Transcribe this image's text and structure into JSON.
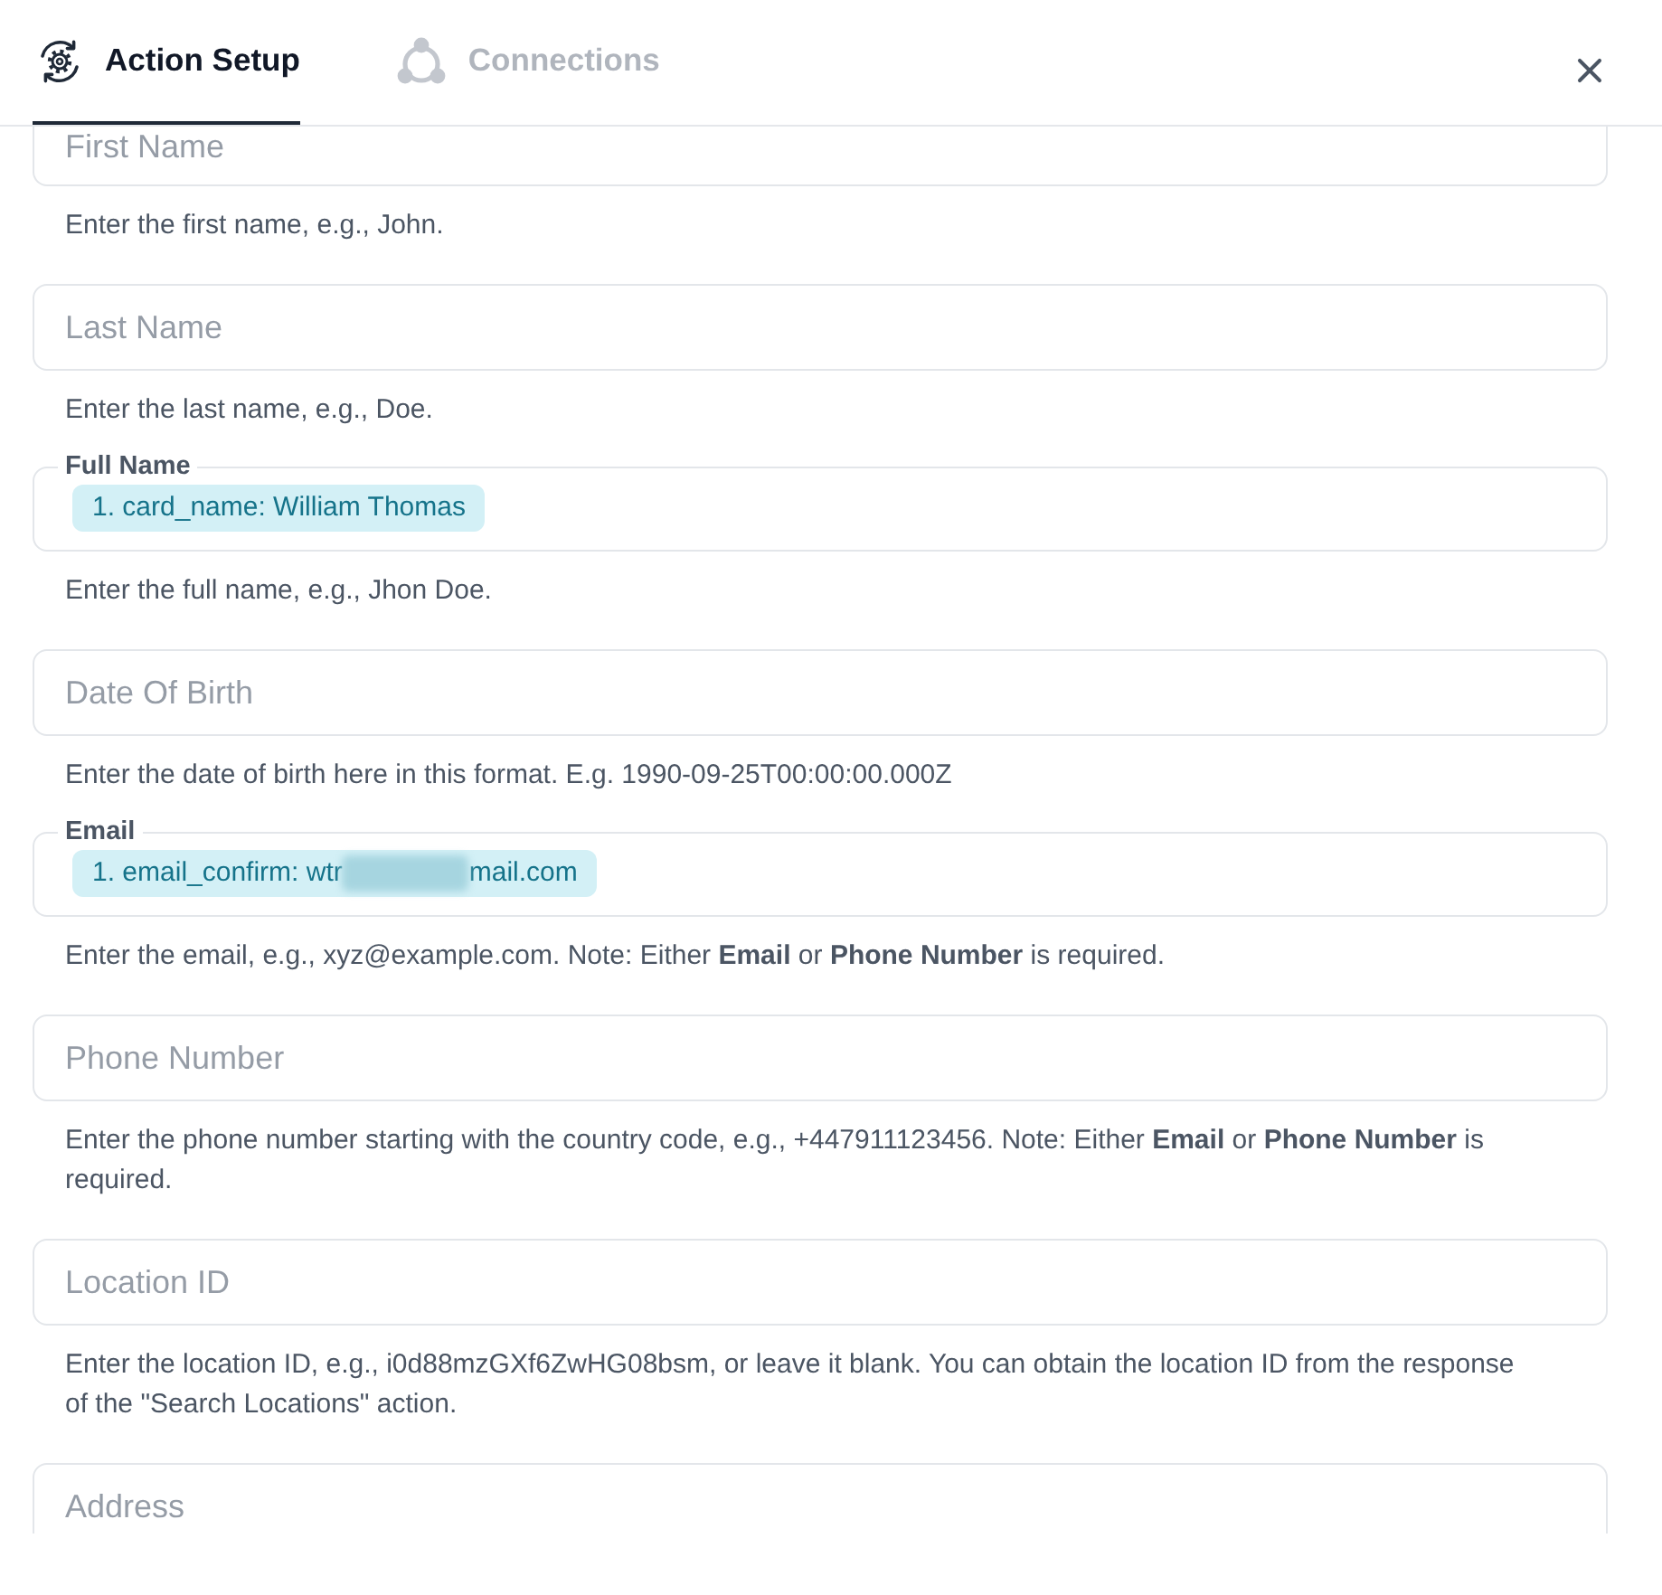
{
  "tabs": [
    {
      "kind": "setup",
      "label": "Action Setup",
      "selected": true
    },
    {
      "kind": "connections",
      "label": "Connections",
      "selected": false
    }
  ],
  "fields": [
    {
      "kind": "empty",
      "placeholder": "First Name",
      "help": "Enter the first name, e.g., John."
    },
    {
      "kind": "empty",
      "placeholder": "Last Name",
      "help": "Enter the last name, e.g., Doe."
    },
    {
      "kind": "filled",
      "label": "Full Name",
      "chips": [
        {
          "text": "1. card_name: William Thomas",
          "redacted": false
        }
      ],
      "help": "Enter the full name, e.g., Jhon Doe."
    },
    {
      "kind": "empty",
      "placeholder": "Date Of Birth",
      "help": "Enter the date of birth here in this format. E.g. 1990-09-25T00:00:00.000Z"
    },
    {
      "kind": "filled",
      "label": "Email",
      "chips": [
        {
          "text": "1. email_confirm: wtr",
          "redacted": true,
          "text_after": "mail.com"
        }
      ],
      "help": "Enter the email, e.g., xyz@example.com. Note: Either **Email** or **Phone Number** is required."
    },
    {
      "kind": "empty",
      "placeholder": "Phone Number",
      "help": "Enter the phone number starting with the country code, e.g., +447911123456. Note: Either **Email** or **Phone Number** is required."
    },
    {
      "kind": "empty",
      "placeholder": "Location ID",
      "help": "Enter the location ID, e.g., i0d88mzGXf6ZwHG08bsm, or leave it blank. You can obtain the location ID from the response of the \"Search Locations\" action."
    },
    {
      "kind": "empty",
      "placeholder": "Address"
    }
  ]
}
